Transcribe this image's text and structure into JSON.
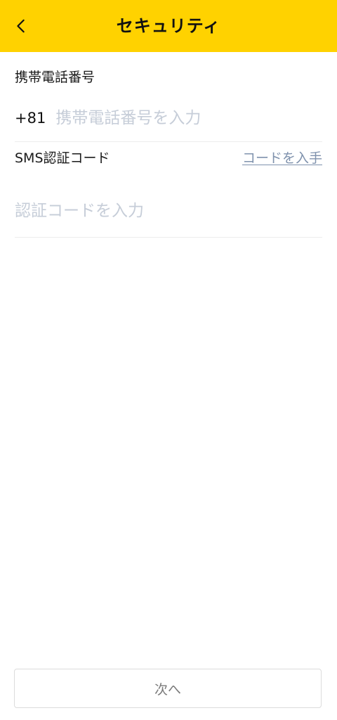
{
  "header": {
    "title": "セキュリティ",
    "back_icon": "chevron-left-icon",
    "background_color": "#ffd200"
  },
  "form": {
    "phone_label": "携帯電話番号",
    "country_code": "+81",
    "phone_placeholder": "携帯電話番号を入力",
    "sms_label": "SMS認証コード",
    "get_code_link": "コードを入手",
    "code_placeholder": "認証コードを入力"
  },
  "footer": {
    "next_label": "次へ"
  }
}
